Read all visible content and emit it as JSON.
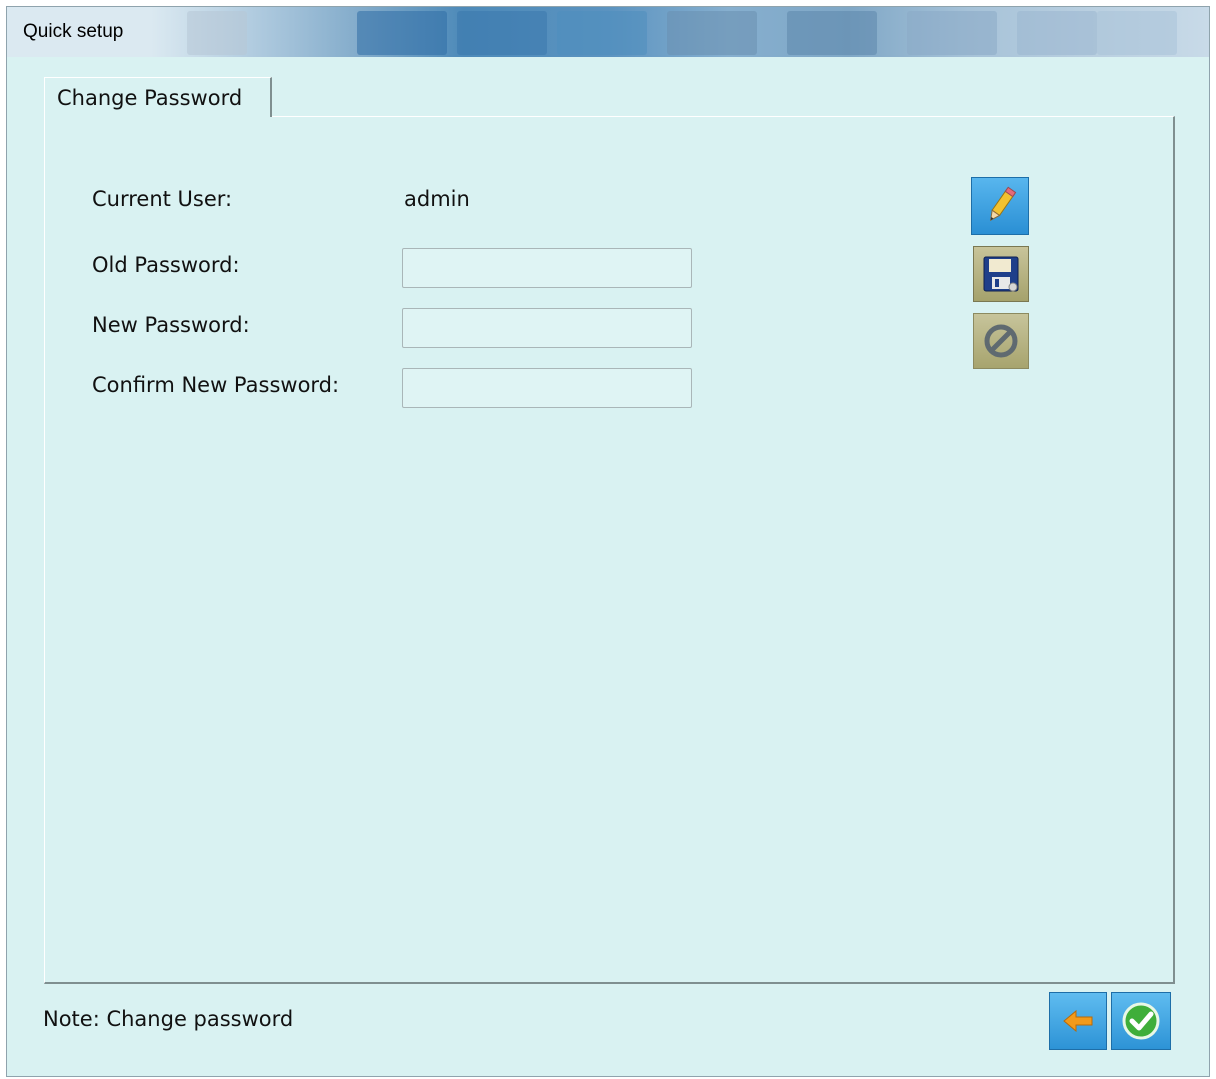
{
  "window": {
    "title": "Quick setup"
  },
  "tabs": [
    {
      "label": "Change Password",
      "active": true
    }
  ],
  "form": {
    "current_user_label": "Current User:",
    "current_user_value": "admin",
    "old_password_label": "Old Password:",
    "old_password_value": "",
    "new_password_label": "New Password:",
    "new_password_value": "",
    "confirm_password_label": "Confirm New Password:",
    "confirm_password_value": ""
  },
  "toolbar": {
    "edit_icon": "pencil-icon",
    "save_icon": "floppy-disk-icon",
    "cancel_icon": "prohibit-icon",
    "cancel_enabled": false
  },
  "footer": {
    "note": "Note: Change password",
    "back_icon": "arrow-left-icon",
    "ok_icon": "checkmark-icon"
  },
  "colors": {
    "background": "#d9f2f2",
    "button_blue": "#2a8fd4",
    "button_khaki": "#a5a26c",
    "arrow_orange": "#f29a1a",
    "check_green": "#3fae3a"
  }
}
